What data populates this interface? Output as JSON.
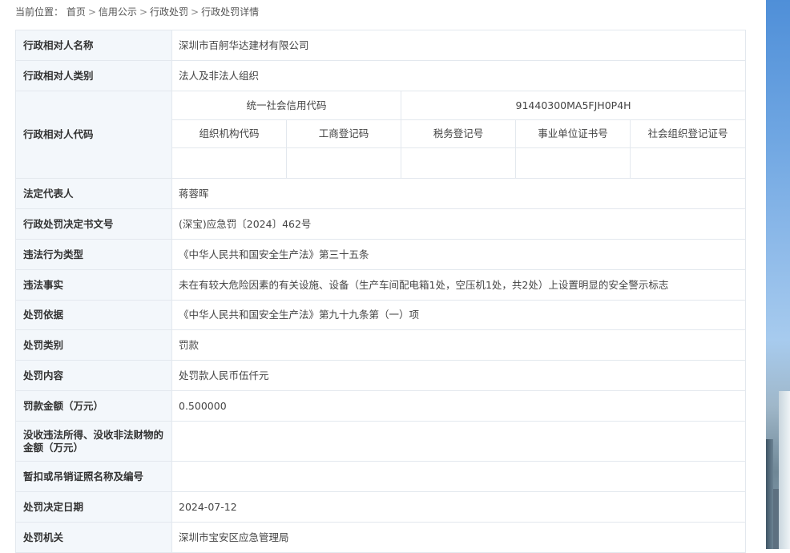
{
  "breadcrumb": {
    "prefix": "当前位置：",
    "items": [
      "首页",
      "信用公示",
      "行政处罚",
      "行政处罚详情"
    ],
    "separator": ">"
  },
  "rows": {
    "subject_name": {
      "label": "行政相对人名称",
      "value": "深圳市百舸华达建材有限公司"
    },
    "subject_type": {
      "label": "行政相对人类别",
      "value": "法人及非法人组织"
    },
    "subject_code": {
      "label": "行政相对人代码",
      "credit_code_label": "统一社会信用代码",
      "credit_code_value": "91440300MA5FJH0P4H",
      "sub_headers": [
        "组织机构代码",
        "工商登记码",
        "税务登记号",
        "事业单位证书号",
        "社会组织登记证号"
      ],
      "sub_values": [
        "",
        "",
        "",
        "",
        ""
      ]
    },
    "legal_rep": {
      "label": "法定代表人",
      "value": "蒋蓉晖"
    },
    "decision_no": {
      "label": "行政处罚决定书文号",
      "value": "(深宝)应急罚〔2024〕462号"
    },
    "violation_type": {
      "label": "违法行为类型",
      "value": "《中华人民共和国安全生产法》第三十五条"
    },
    "violation_fact": {
      "label": "违法事实",
      "value": "未在有较大危险因素的有关设施、设备（生产车间配电箱1处，空压机1处，共2处）上设置明显的安全警示标志"
    },
    "basis": {
      "label": "处罚依据",
      "value": "《中华人民共和国安全生产法》第九十九条第（一）项"
    },
    "category": {
      "label": "处罚类别",
      "value": "罚款"
    },
    "content": {
      "label": "处罚内容",
      "value": "处罚款人民币伍仟元"
    },
    "fine_amount": {
      "label": "罚款金额（万元）",
      "value": "0.500000"
    },
    "confiscation": {
      "label": "没收违法所得、没收非法财物的金额（万元）",
      "value": ""
    },
    "license": {
      "label": "暂扣或吊销证照名称及编号",
      "value": ""
    },
    "decision_date": {
      "label": "处罚决定日期",
      "value": "2024-07-12"
    },
    "authority": {
      "label": "处罚机关",
      "value": "深圳市宝安区应急管理局"
    }
  },
  "colors": {
    "label_bg": "#f3f7fb",
    "border": "#e3e8ee"
  }
}
